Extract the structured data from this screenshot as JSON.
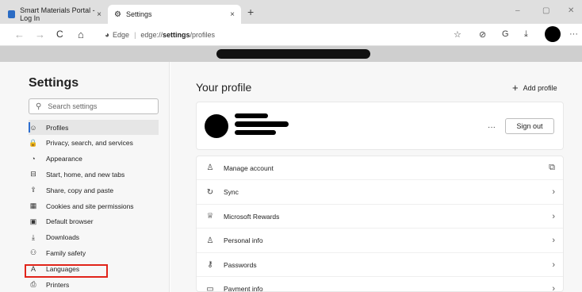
{
  "browser": {
    "tabs": [
      {
        "title": "Smart Materials Portal - Log In",
        "close": "×"
      },
      {
        "title": "Settings",
        "close": "×"
      }
    ],
    "new_tab": "+",
    "window_controls": {
      "minimize": "–",
      "maximize": "▢",
      "close": "✕"
    },
    "nav": {
      "back": "←",
      "forward": "→",
      "refresh": "C",
      "home": "⌂"
    },
    "address": {
      "brand": "Edge",
      "separator": "|",
      "prefix": "edge://",
      "bold": "settings",
      "suffix": "/profiles"
    },
    "toolbar_icons": {
      "favorites": "☆",
      "collections": "⊘",
      "sync": "G",
      "downloads": "⤓",
      "more": "···"
    }
  },
  "sidebar": {
    "title": "Settings",
    "search_placeholder": "Search settings",
    "items": [
      {
        "label": "Profiles",
        "icon": "profile-icon",
        "glyph": "☺"
      },
      {
        "label": "Privacy, search, and services",
        "icon": "lock-icon",
        "glyph": "🔒"
      },
      {
        "label": "Appearance",
        "icon": "appearance-icon",
        "glyph": "◔"
      },
      {
        "label": "Start, home, and new tabs",
        "icon": "home-icon",
        "glyph": "⊟"
      },
      {
        "label": "Share, copy and paste",
        "icon": "share-icon",
        "glyph": "⇪"
      },
      {
        "label": "Cookies and site permissions",
        "icon": "cookie-icon",
        "glyph": "▦"
      },
      {
        "label": "Default browser",
        "icon": "browser-icon",
        "glyph": "▣"
      },
      {
        "label": "Downloads",
        "icon": "download-icon",
        "glyph": "⤓"
      },
      {
        "label": "Family safety",
        "icon": "family-icon",
        "glyph": "⚇"
      },
      {
        "label": "Languages",
        "icon": "languages-icon",
        "glyph": "A"
      },
      {
        "label": "Printers",
        "icon": "printer-icon",
        "glyph": "⎙"
      }
    ]
  },
  "main": {
    "title": "Your profile",
    "add_profile": "Add profile",
    "add_icon": "+",
    "more": "···",
    "sign_out": "Sign out",
    "rows": [
      {
        "label": "Manage account",
        "icon": "account-icon",
        "glyph": "♙",
        "trail": "⧉"
      },
      {
        "label": "Sync",
        "icon": "sync-icon",
        "glyph": "↻",
        "trail": "›"
      },
      {
        "label": "Microsoft Rewards",
        "icon": "rewards-icon",
        "glyph": "♕",
        "trail": "›"
      },
      {
        "label": "Personal info",
        "icon": "person-icon",
        "glyph": "♙",
        "trail": "›"
      },
      {
        "label": "Passwords",
        "icon": "key-icon",
        "glyph": "⚷",
        "trail": "›"
      },
      {
        "label": "Payment info",
        "icon": "card-icon",
        "glyph": "▭",
        "trail": "›"
      }
    ]
  },
  "colors": {
    "accent": "#2f6fd0",
    "highlight": "#e1241a"
  }
}
